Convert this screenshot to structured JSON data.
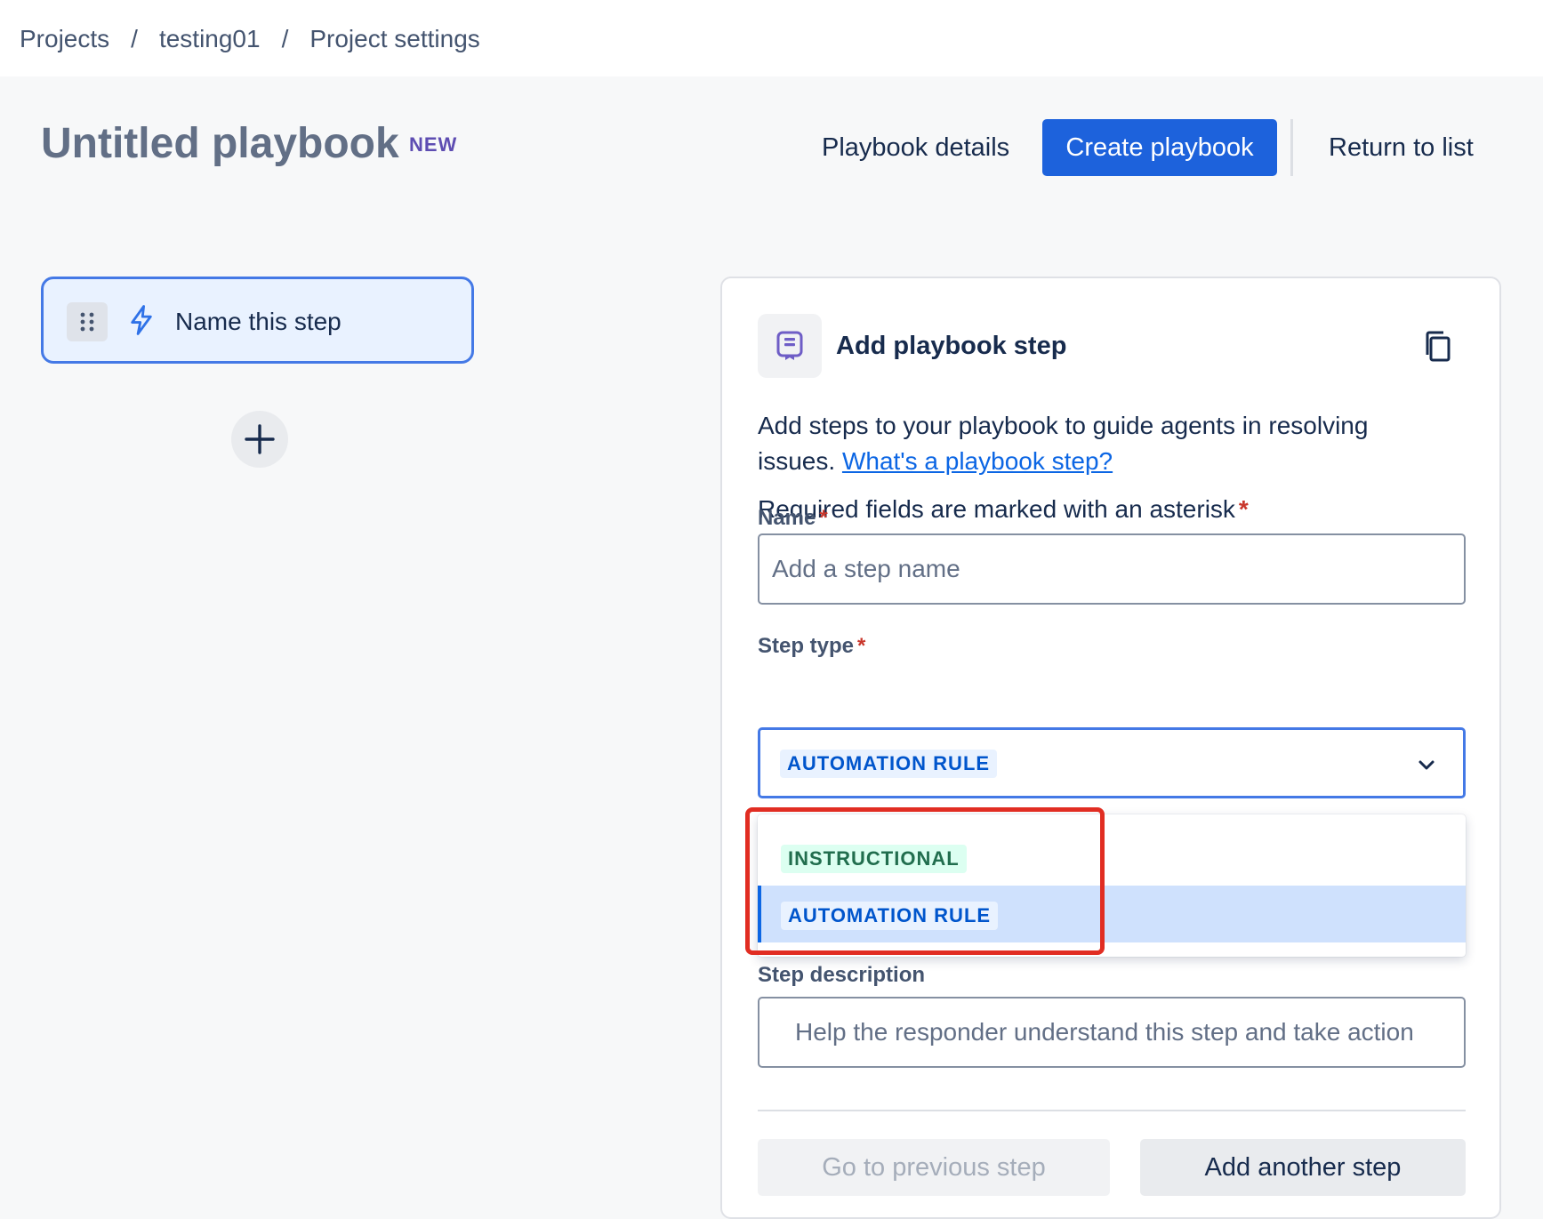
{
  "breadcrumb": {
    "items": [
      "Projects",
      "testing01",
      "Project settings"
    ],
    "separator": "/"
  },
  "header": {
    "title": "Untitled playbook",
    "badge": "NEW",
    "details_label": "Playbook details",
    "create_label": "Create playbook",
    "return_label": "Return to list"
  },
  "steps_list": {
    "items": [
      {
        "label": "Name this step",
        "icon": "lightning-bolt-icon"
      }
    ],
    "add_icon": "plus-icon"
  },
  "panel": {
    "title": "Add playbook step",
    "header_icon": "playbook-step-icon",
    "copy_icon": "copy-icon",
    "intro_text": "Add steps to your playbook to guide agents in resolving issues.",
    "intro_link": "What's a playbook step?",
    "required_note": "Required fields are marked with an asterisk",
    "asterisk": "*",
    "name_field": {
      "label": "Name",
      "placeholder": "Add a step name",
      "value": ""
    },
    "step_type": {
      "label": "Step type",
      "selected": "AUTOMATION RULE",
      "options": [
        "INSTRUCTIONAL",
        "AUTOMATION RULE"
      ]
    },
    "description": {
      "label": "Step description",
      "placeholder": "Help the responder understand this step and take action"
    },
    "prev_label": "Go to previous step",
    "next_label": "Add another step"
  },
  "colors": {
    "primary": "#1d62dc",
    "focus_border": "#4479e6",
    "highlight_annotation": "#e12d22",
    "lozenge_blue_text": "#0055cc",
    "lozenge_green_text": "#216e4e"
  }
}
